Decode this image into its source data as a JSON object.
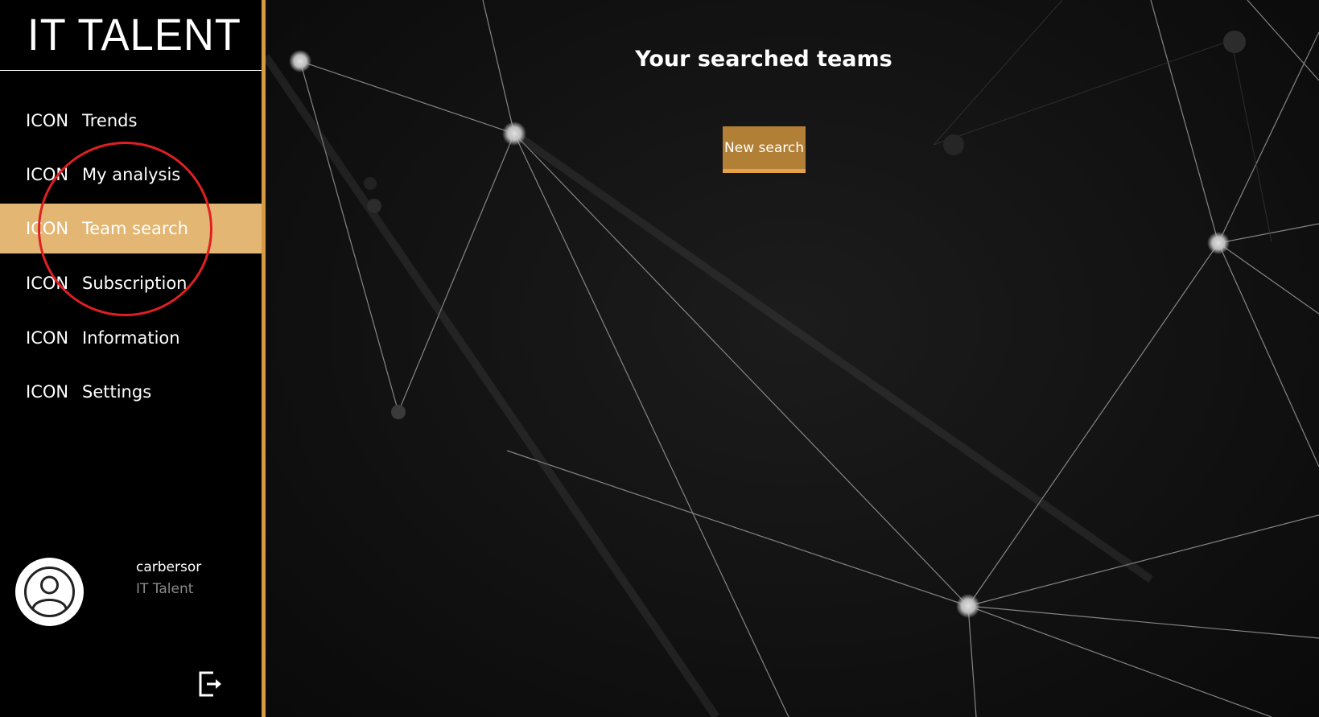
{
  "brand": {
    "title": "IT TALENT"
  },
  "nav": {
    "items": [
      {
        "icon": "ICON",
        "label": "Trends",
        "active": false
      },
      {
        "icon": "ICON",
        "label": "My analysis",
        "active": false
      },
      {
        "icon": "ICON",
        "label": "Team search",
        "active": true
      },
      {
        "icon": "ICON",
        "label": "Subscription",
        "active": false
      },
      {
        "icon": "ICON",
        "label": "Information",
        "active": false
      },
      {
        "icon": "ICON",
        "label": "Settings",
        "active": false
      }
    ]
  },
  "profile": {
    "username": "carbersor",
    "organization": "IT Talent",
    "avatar_icon": "user-avatar-icon"
  },
  "actions": {
    "logout_icon": "logout-icon",
    "collapse_icon": "chevron-left-icon"
  },
  "main": {
    "title": "Your searched teams",
    "new_search_label": "New search"
  },
  "colors": {
    "accent": "#d69a45",
    "active_nav_bg": "#e4b673",
    "button_bg": "#b27f36",
    "annotation": "#e01f24"
  }
}
